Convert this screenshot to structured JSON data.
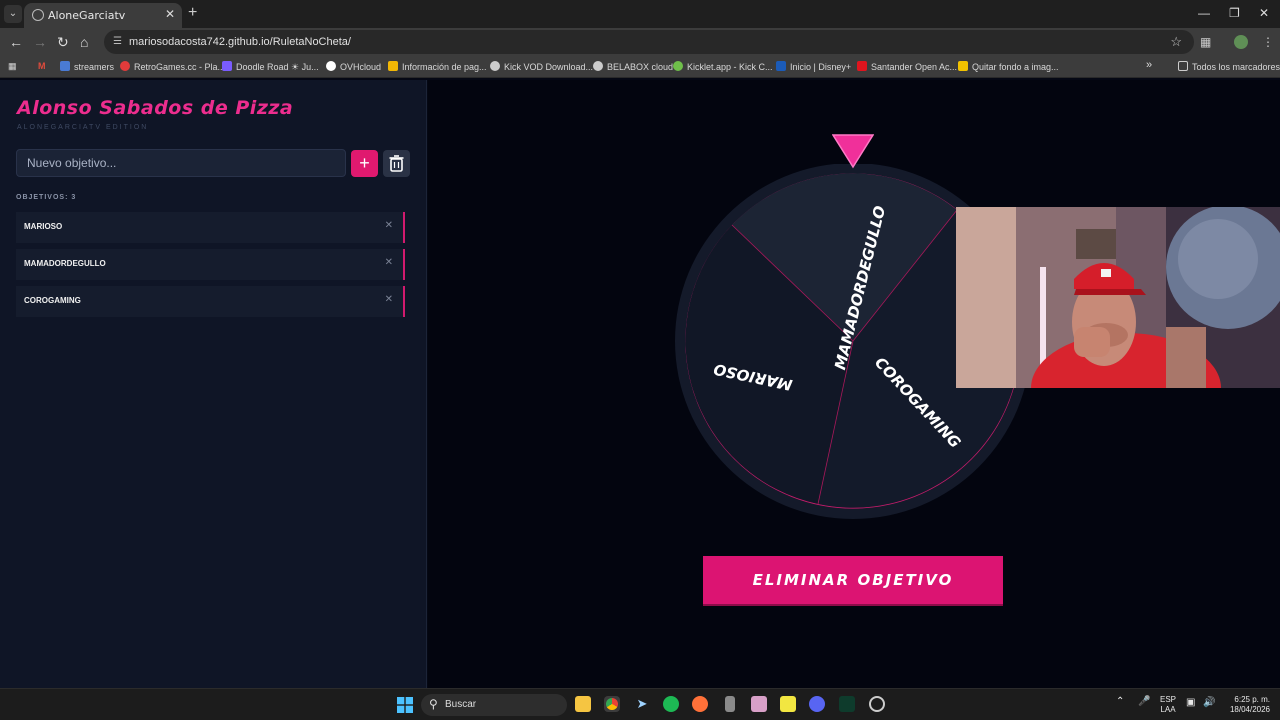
{
  "browser": {
    "tab_title": "AloneGarciatv",
    "url": "mariosodacosta742.github.io/RuletaNoCheta/",
    "bookmarks": [
      {
        "label": "streamers",
        "color": "#4a7bd4"
      },
      {
        "label": "RetroGames.cc - Pla...",
        "color": "#e23b3b"
      },
      {
        "label": "Doodle Road ☀ Ju...",
        "color": "#7a5cff"
      },
      {
        "label": "OVHcloud",
        "color": "#ffffff"
      },
      {
        "label": "Información de pag...",
        "color": "#f2b705"
      },
      {
        "label": "Kick VOD Download...",
        "color": "#cccccc"
      },
      {
        "label": "BELABOX cloud",
        "color": "#cccccc"
      },
      {
        "label": "Kicklet.app - Kick C...",
        "color": "#6fbf4a"
      },
      {
        "label": "Inicio | Disney+",
        "color": "#1b5bb8"
      },
      {
        "label": "Santander Open Ac...",
        "color": "#e0141e"
      },
      {
        "label": "Quitar fondo a imag...",
        "color": "#f2c200"
      }
    ],
    "all_bookmarks": "Todos los marcadores"
  },
  "app": {
    "title": "Alonso Sabados de Pizza",
    "subtitle": "ALONEGARCIATV EDITION",
    "input_placeholder": "Nuevo objetivo...",
    "add_label": "+",
    "count_label": "OBJETIVOS: 3",
    "items": [
      {
        "label": "MARIOSO"
      },
      {
        "label": "MAMADORDEGULLO"
      },
      {
        "label": "COROGAMING"
      }
    ],
    "spin_button": "ELIMINAR OBJETIVO",
    "accent": "#e0196f"
  },
  "wheel": {
    "segments": [
      "MARIOSO",
      "MAMADORDEGULLO",
      "COROGAMING"
    ]
  },
  "taskbar": {
    "search": "Buscar",
    "lang_top": "ESP",
    "lang_bottom": "LAA",
    "time": "6:25 p. m.",
    "date": "18/04/2026"
  }
}
